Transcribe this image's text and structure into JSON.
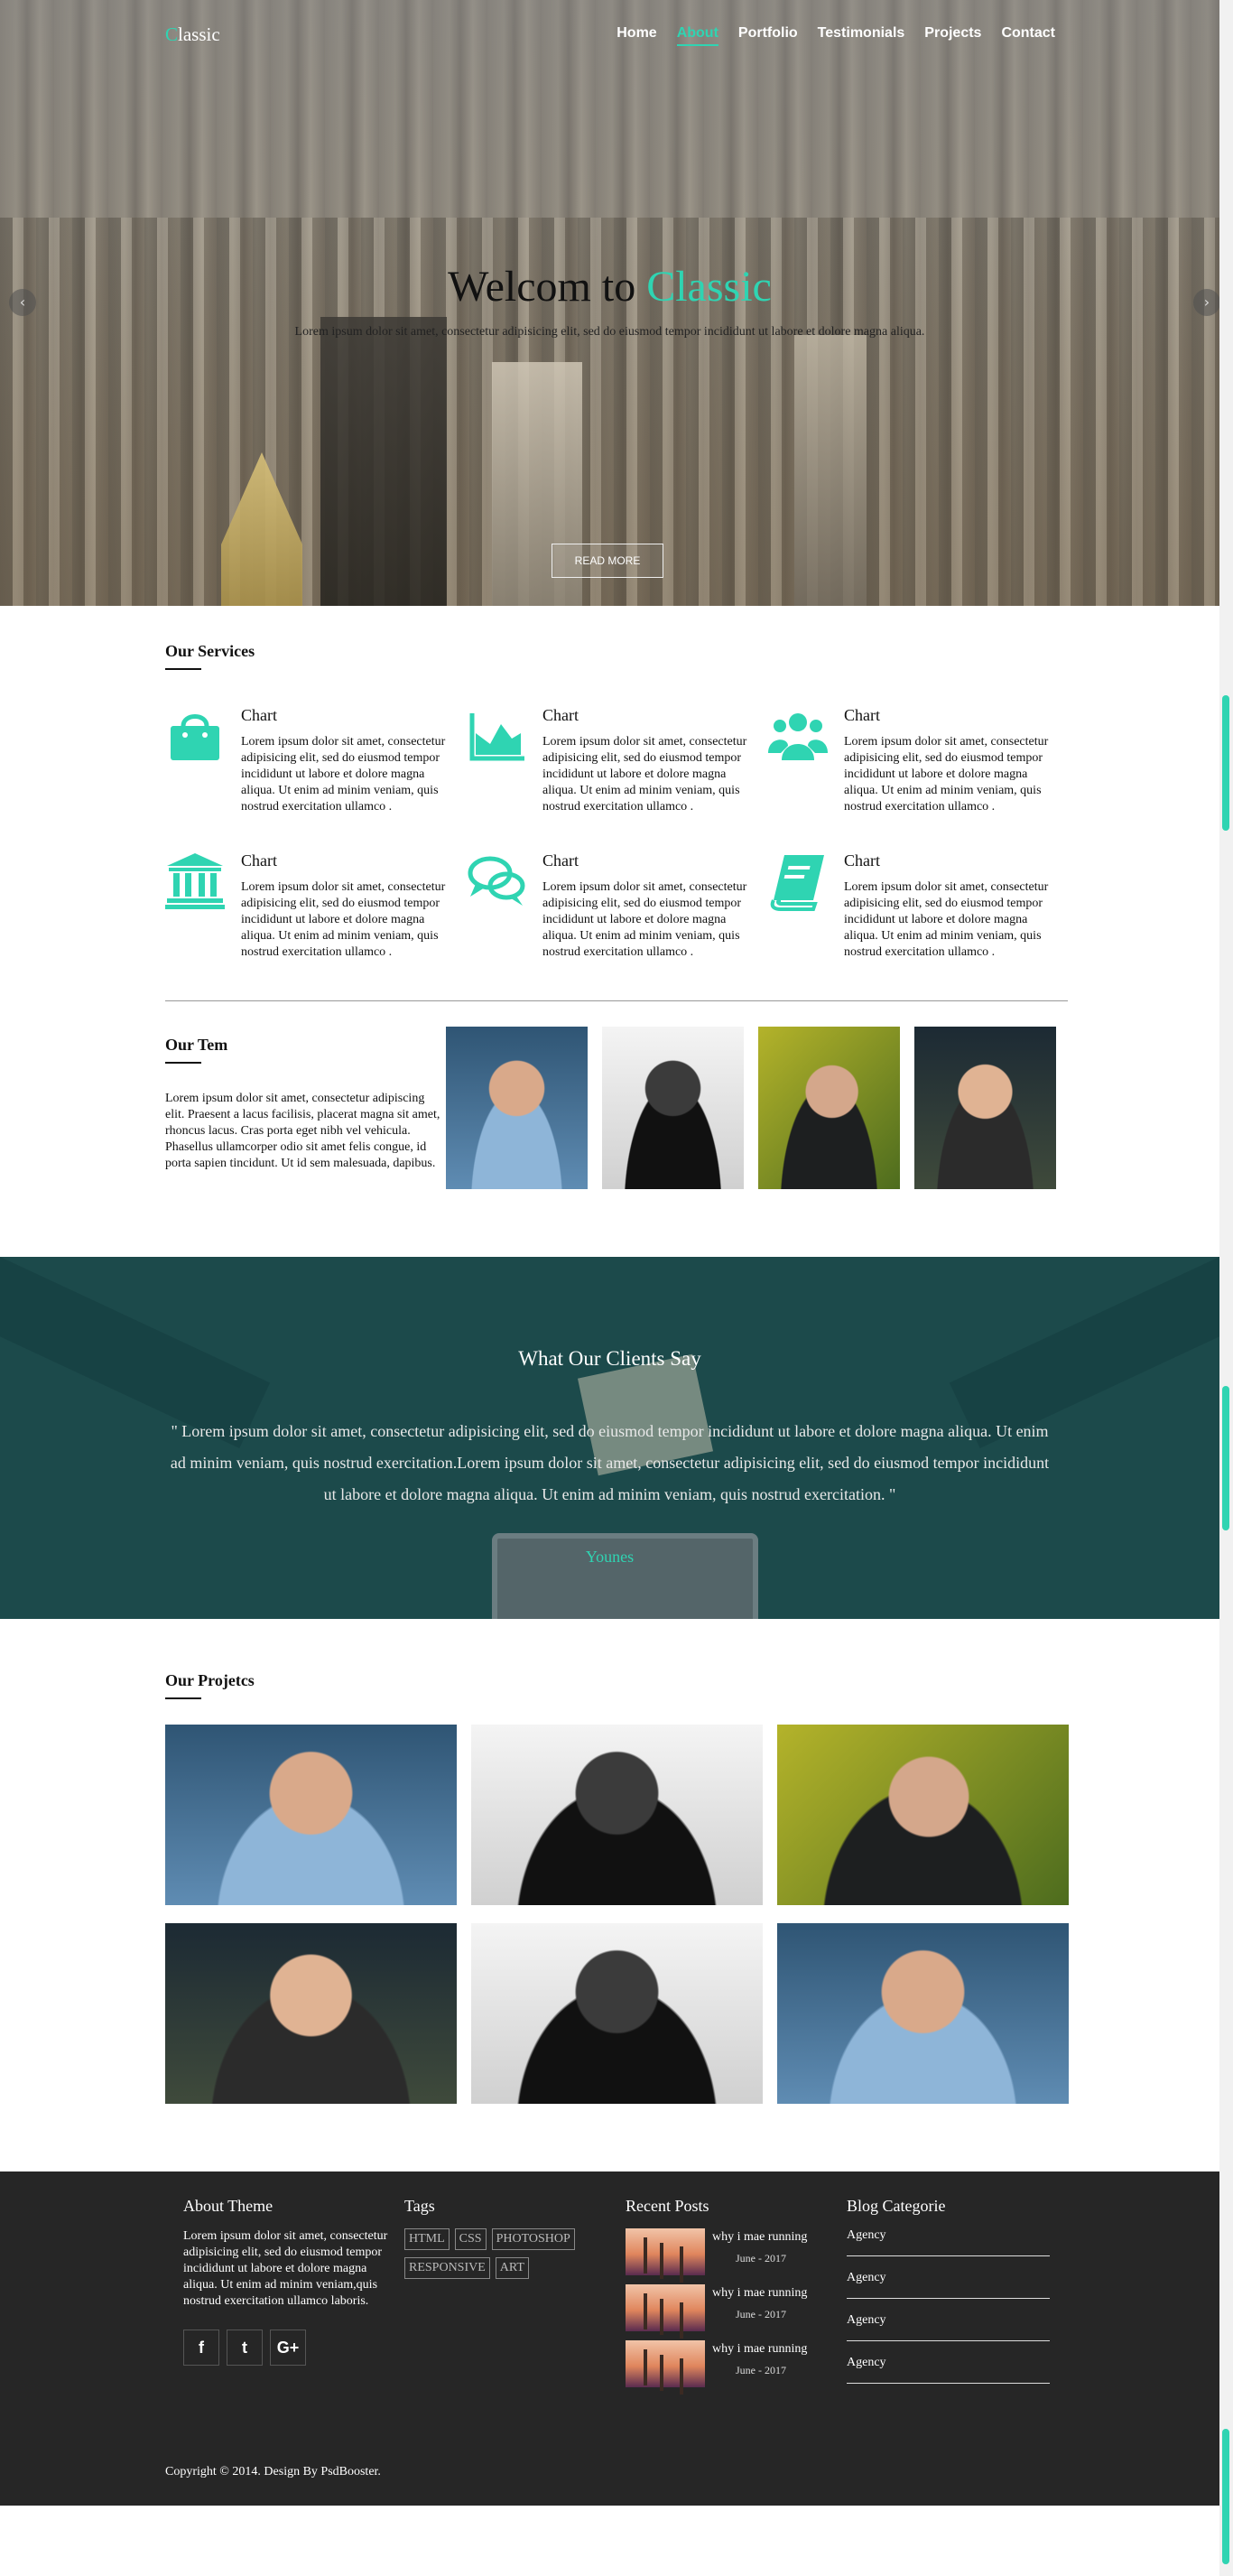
{
  "nav": {
    "logo_first": "C",
    "logo_rest": "lassic",
    "items": [
      {
        "label": "Home"
      },
      {
        "label": "About"
      },
      {
        "label": "Portfolio"
      },
      {
        "label": "Testimonials"
      },
      {
        "label": "Projects"
      },
      {
        "label": "Contact"
      }
    ],
    "active_index": 1
  },
  "hero": {
    "title_prefix": "Welcom to ",
    "title_accent": "Classic",
    "subtitle": "Lorem ipsum dolor sit amet, consectetur adipisicing elit, sed do eiusmod tempor incididunt ut labore et dolore magna aliqua.",
    "button": "READ MORE",
    "prev_arrow": "‹",
    "next_arrow": "›"
  },
  "services": {
    "title": "Our Services",
    "items": [
      {
        "icon": "shopping-bag-icon",
        "title": "Chart",
        "text": "Lorem ipsum dolor sit amet, consectetur adipisicing elit, sed do eiusmod tempor incididunt ut labore et dolore magna aliqua. Ut enim ad minim veniam, quis nostrud exercitation ullamco ."
      },
      {
        "icon": "area-chart-icon",
        "title": "Chart",
        "text": "Lorem ipsum dolor sit amet, consectetur adipisicing elit, sed do eiusmod tempor incididunt ut labore et dolore magna aliqua. Ut enim ad minim veniam, quis nostrud exercitation ullamco ."
      },
      {
        "icon": "users-icon",
        "title": "Chart",
        "text": "Lorem ipsum dolor sit amet, consectetur adipisicing elit, sed do eiusmod tempor incididunt ut labore et dolore magna aliqua. Ut enim ad minim veniam, quis nostrud exercitation ullamco ."
      },
      {
        "icon": "bank-icon",
        "title": "Chart",
        "text": "Lorem ipsum dolor sit amet, consectetur adipisicing elit, sed do eiusmod tempor incididunt ut labore et dolore magna aliqua. Ut enim ad minim veniam, quis nostrud exercitation ullamco ."
      },
      {
        "icon": "comments-icon",
        "title": "Chart",
        "text": "Lorem ipsum dolor sit amet, consectetur adipisicing elit, sed do eiusmod tempor incididunt ut labore et dolore magna aliqua. Ut enim ad minim veniam, quis nostrud exercitation ullamco ."
      },
      {
        "icon": "book-icon",
        "title": "Chart",
        "text": "Lorem ipsum dolor sit amet, consectetur adipisicing elit, sed do eiusmod tempor incididunt ut labore et dolore magna aliqua. Ut enim ad minim veniam, quis nostrud exercitation ullamco ."
      }
    ]
  },
  "team": {
    "title": "Our Tem",
    "text": "Lorem ipsum dolor sit amet, consectetur adipiscing elit. Praesent a lacus facilisis, placerat magna sit amet, rhoncus lacus. Cras porta eget nibh vel vehicula. Phasellus ullamcorper odio sit amet felis congue, id porta sapien tincidunt. Ut id sem malesuada, dapibus."
  },
  "testimonials": {
    "title": "What Our Clients Say",
    "quote": "\" Lorem ipsum dolor sit amet, consectetur adipisicing elit, sed do eiusmod tempor incididunt ut labore et dolore magna aliqua. Ut enim ad minim veniam, quis nostrud exercitation.Lorem ipsum dolor sit amet, consectetur adipisicing elit, sed do eiusmod tempor incididunt ut labore et dolore magna aliqua. Ut enim ad minim veniam, quis nostrud exercitation. \"",
    "author": "Younes"
  },
  "projects": {
    "title": "Our Projetcs"
  },
  "footer": {
    "about_title": "About Theme",
    "about_text": "Lorem ipsum dolor sit amet, consectetur adipisicing elit, sed do eiusmod tempor incididunt ut labore et dolore magna aliqua. Ut enim ad minim veniam,quis nostrud exercitation ullamco laboris.",
    "socials": [
      "f",
      "t",
      "G+"
    ],
    "tags_title": "Tags",
    "tags": [
      "HTML",
      "CSS",
      "PHOTOSHOP",
      "RESPONSIVE",
      "ART"
    ],
    "posts_title": "Recent Posts",
    "posts": [
      {
        "title": "why i mae running",
        "date": "June - 2017"
      },
      {
        "title": "why i mae running",
        "date": "June - 2017"
      },
      {
        "title": "why i mae running",
        "date": "June - 2017"
      }
    ],
    "categories_title": "Blog Categorie",
    "categories": [
      "Agency",
      "Agency",
      "Agency",
      "Agency"
    ],
    "copyright": "Copyright © 2014. Design By PsdBooster."
  },
  "colors": {
    "accent": "#2fd4b2",
    "testimonial_bg": "#1c4a4b",
    "footer_bg": "#262626"
  }
}
